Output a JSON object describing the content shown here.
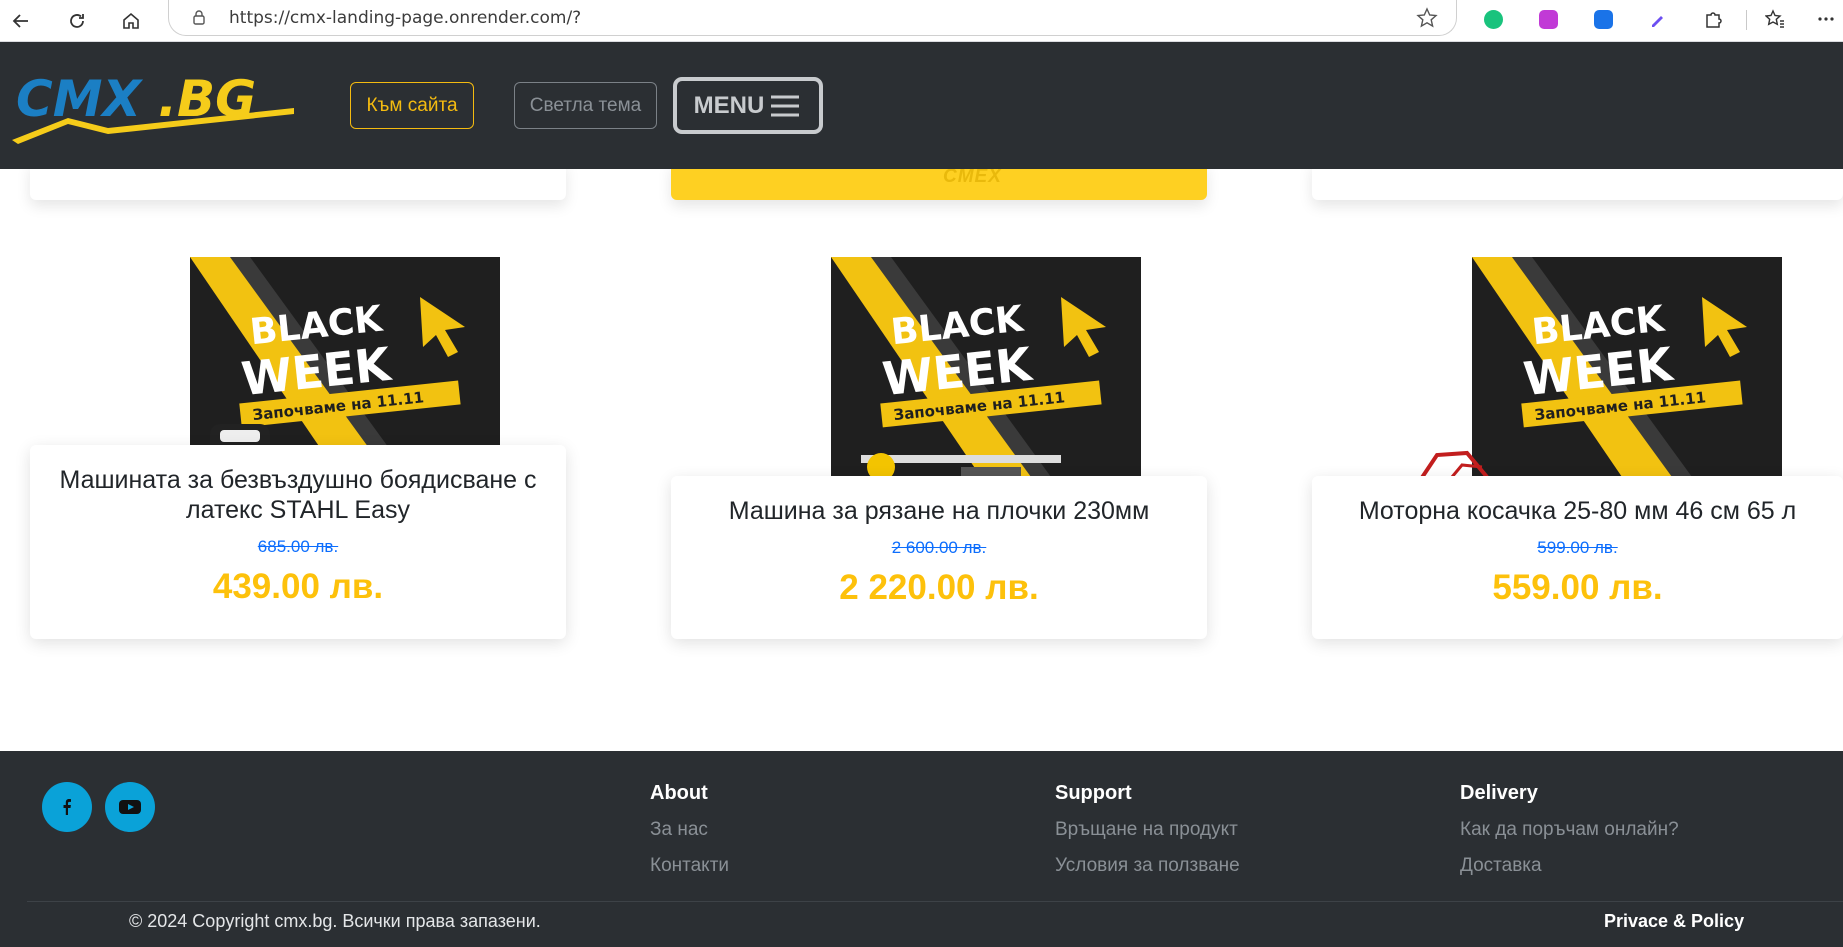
{
  "browser": {
    "url": "https://cmx-landing-page.onrender.com/?"
  },
  "header": {
    "logo_text": "CMX.BG",
    "to_site_label": "Към сайта",
    "theme_label": "Светла тема",
    "menu_label": "MENU"
  },
  "top_cards": {
    "middle_logo": "CMEX"
  },
  "banner": {
    "line1": "BLACK",
    "line2": "WEEK",
    "subtitle": "Започваме на 11.11"
  },
  "products": [
    {
      "name": "Машината за безвъздушно боядисване с латекс STAHL Easy",
      "old_price": "685.00 лв.",
      "price": "439.00 лв."
    },
    {
      "name": "Машина за рязане на плочки 230мм",
      "old_price": "2 600.00 лв.",
      "price": "2 220.00 лв."
    },
    {
      "name": "Моторна косачка 25-80 мм 46 см 65 л",
      "old_price": "599.00 лв.",
      "price": "559.00 лв."
    }
  ],
  "footer": {
    "about": {
      "title": "About",
      "links": [
        "За нас",
        "Контакти"
      ]
    },
    "support": {
      "title": "Support",
      "links": [
        "Връщане на продукт",
        "Условия за ползване"
      ]
    },
    "delivery": {
      "title": "Delivery",
      "links": [
        "Как да поръчам онлайн?",
        "Доставка"
      ]
    },
    "copyright": "© 2024 Copyright cmx.bg. Всички права запазени.",
    "privacy": "Privace & Policy"
  },
  "colors": {
    "accent_yellow": "#fdc10b",
    "dark_bg": "#2b2f33",
    "old_price_blue": "#0d6efd",
    "social_blue": "#0aa2d8"
  }
}
